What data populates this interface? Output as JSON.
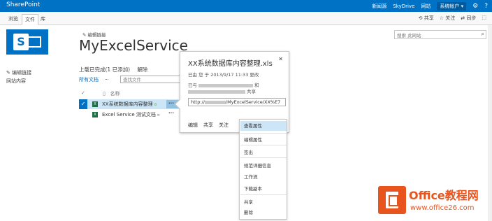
{
  "topbar": {
    "brand": "SharePoint",
    "links": [
      "新闻源",
      "SkyDrive",
      "网站"
    ],
    "user": "系统帐户 ▾",
    "icons": [
      "gear-icon",
      "help-icon"
    ]
  },
  "ribbon": {
    "tabs": [
      "浏览",
      "文件",
      "库"
    ],
    "selected_tab": "文件",
    "actions": [
      "共享",
      "关注",
      "同步"
    ]
  },
  "header": {
    "edit_link": "编辑链接",
    "title": "MyExcelService",
    "search_placeholder": "搜索 此网站"
  },
  "leftnav": {
    "edit_link": "编辑链接",
    "items": [
      "网站内容"
    ]
  },
  "library": {
    "upload_status": "上载已完成(1 已添加)",
    "undo": "解除",
    "view": "所有文档",
    "more": "···",
    "find_placeholder": "查找文件",
    "column_name": "名称",
    "rows": [
      {
        "name": "XX系统数据库内容整理",
        "new_marker": "¤",
        "more": "···"
      },
      {
        "name": "Excel Service 测试文档",
        "new_marker": "¤",
        "more": "···"
      }
    ]
  },
  "callout": {
    "title": "XX系统数据库内容整理.xls",
    "modified": "已由 您 于 2013/9/17 11:33 更改",
    "shared_prefix": "已与",
    "shared_and": "和",
    "shared_suffix": "共享",
    "url_prefix": "http://",
    "url_suffix": "/MyExcelService/XX%E7",
    "actions": [
      "编辑",
      "共享",
      "关注"
    ],
    "more": "···"
  },
  "menu": {
    "items": [
      "查看属性",
      "编辑属性",
      "签出",
      "规范详细信息",
      "工作流",
      "下载副本",
      "共享",
      "删除"
    ],
    "highlighted": "查看属性"
  },
  "watermark": {
    "line1": "Office教程网",
    "line2": "www.office26.com"
  },
  "colors": {
    "brand_blue": "#0072c6",
    "selection": "#cde6f7",
    "watermark_orange": "#e8541e"
  }
}
